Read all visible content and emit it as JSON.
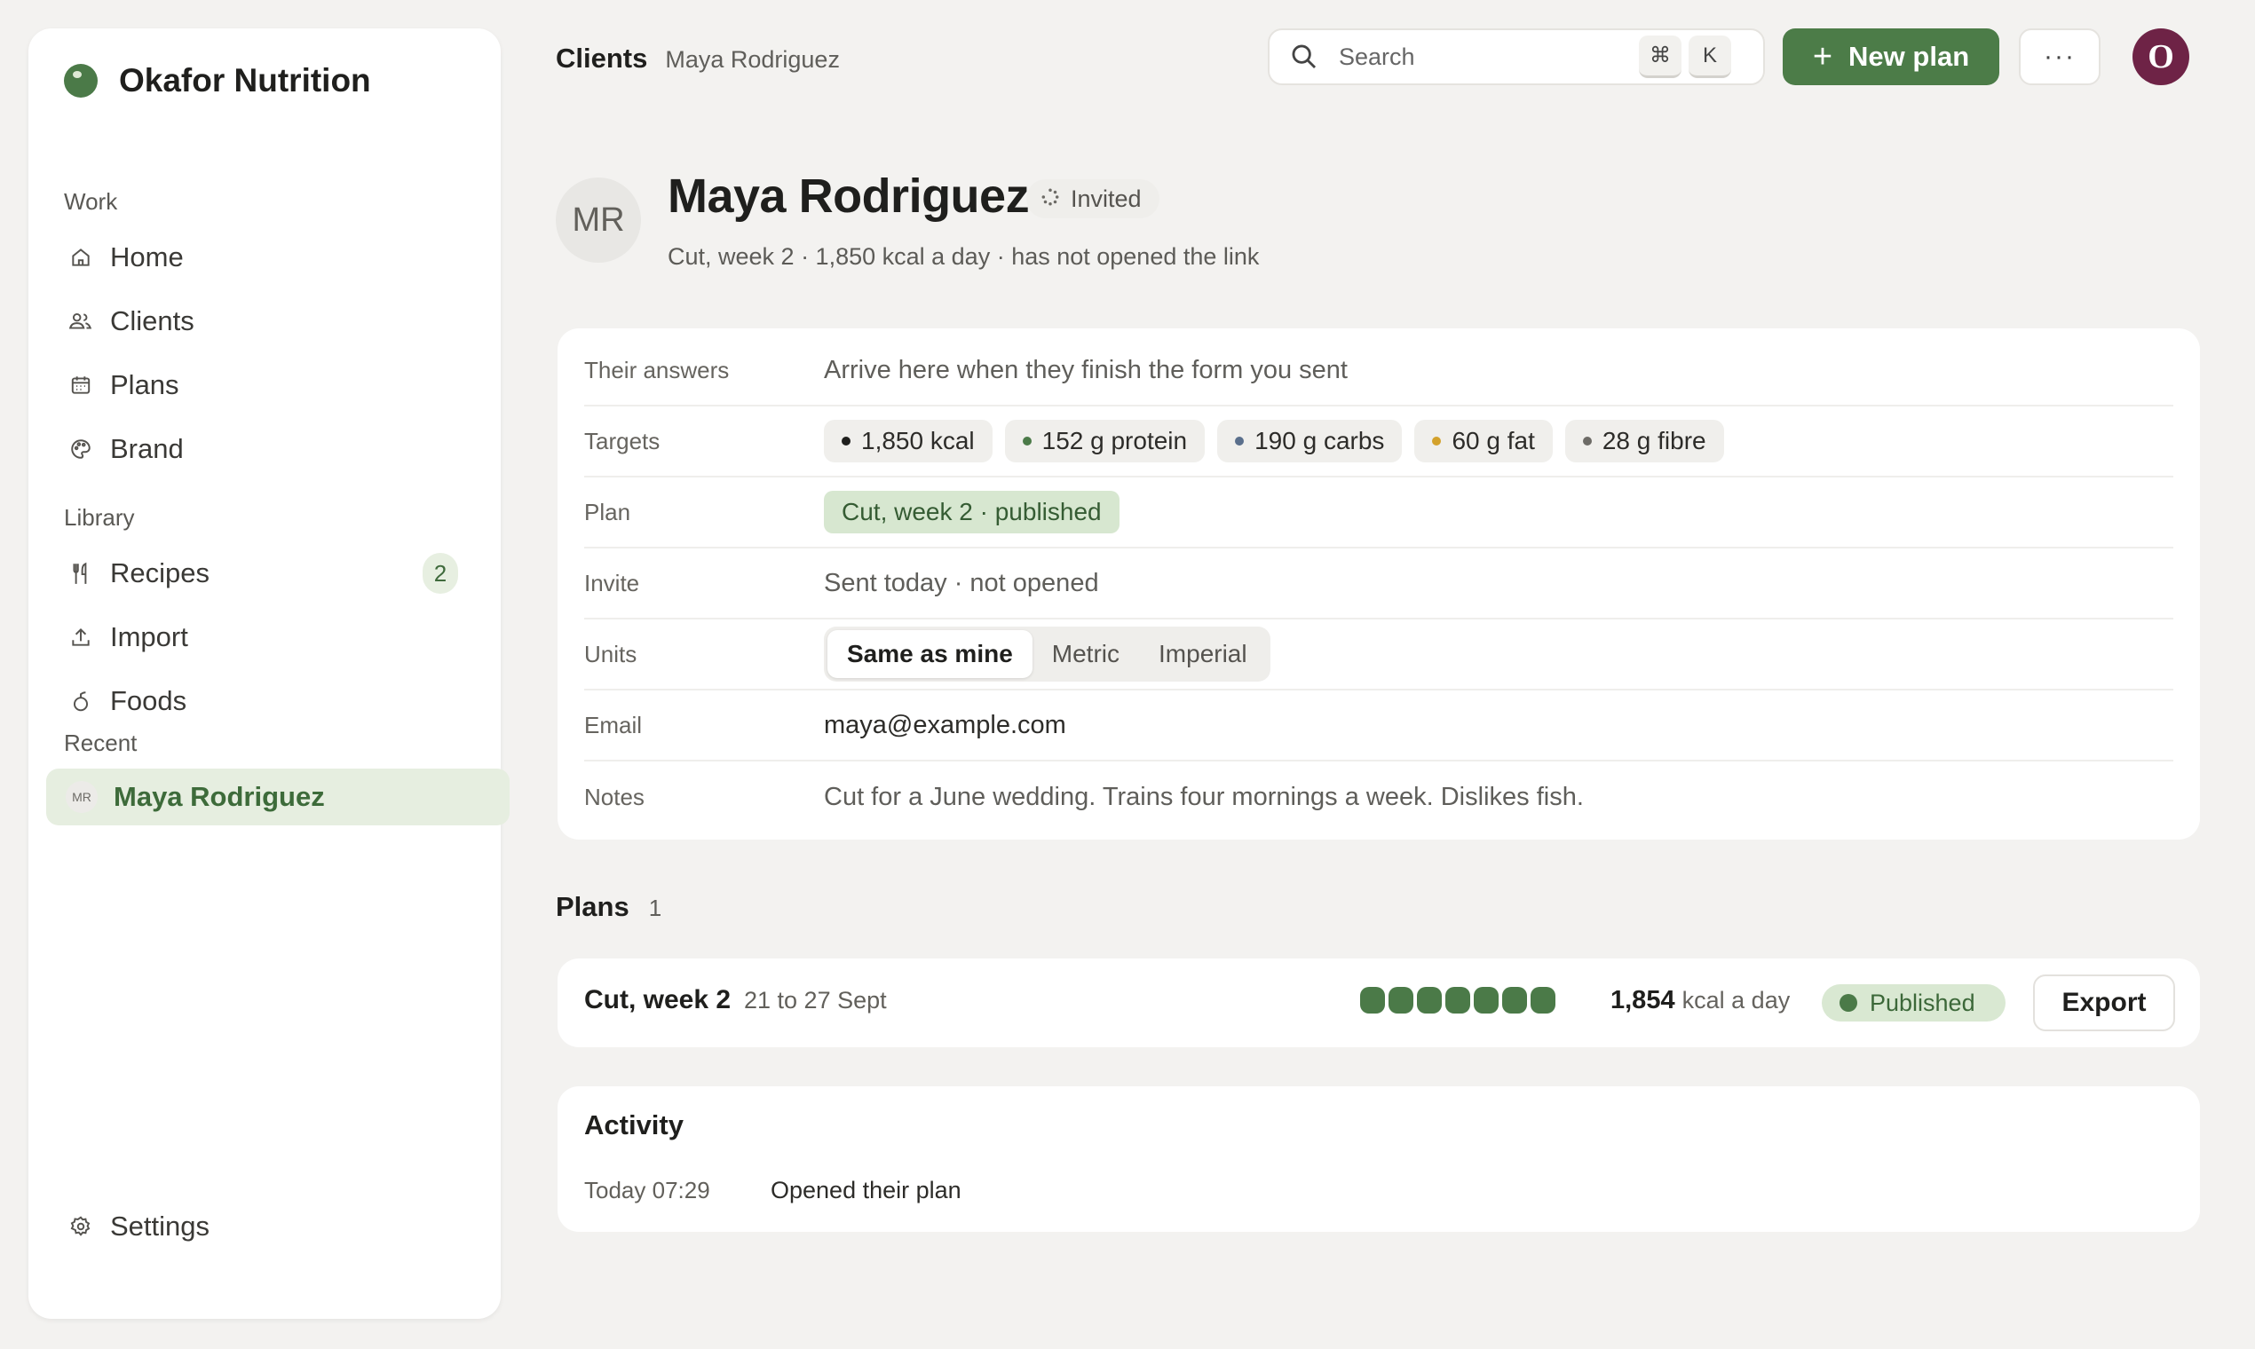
{
  "sidebar": {
    "brand": "Okafor Nutrition",
    "sections": {
      "work": "Work",
      "library": "Library",
      "recent": "Recent"
    },
    "work_items": [
      {
        "label": "Home",
        "icon": "home-icon"
      },
      {
        "label": "Clients",
        "icon": "users-icon"
      },
      {
        "label": "Plans",
        "icon": "calendar-icon"
      },
      {
        "label": "Brand",
        "icon": "palette-icon"
      }
    ],
    "library_items": [
      {
        "label": "Recipes",
        "icon": "utensils-icon",
        "badge": "2"
      },
      {
        "label": "Import",
        "icon": "upload-icon"
      },
      {
        "label": "Foods",
        "icon": "apple-icon"
      }
    ],
    "recent": {
      "initials": "MR",
      "label": "Maya Rodriguez"
    },
    "settings": "Settings"
  },
  "topbar": {
    "breadcrumb_main": "Clients",
    "breadcrumb_sub": "Maya Rodriguez",
    "search_placeholder": "Search",
    "kbd_cmd": "⌘",
    "kbd_k": "K",
    "new_plan": "New plan",
    "more": "···",
    "user_initial": "O"
  },
  "client": {
    "initials": "MR",
    "name": "Maya Rodriguez",
    "status": "Invited",
    "subtitle": "Cut, week 2 · 1,850 kcal a day · has not opened the link"
  },
  "details": {
    "answers_label": "Their answers",
    "answers_value": "Arrive here when they finish the form you sent",
    "targets_label": "Targets",
    "targets": [
      {
        "text": "1,850 kcal",
        "color": "#1f1f1d"
      },
      {
        "text": "152 g protein",
        "color": "#4b7a48"
      },
      {
        "text": "190 g carbs",
        "color": "#5a6f8c"
      },
      {
        "text": "60 g fat",
        "color": "#d3a12b"
      },
      {
        "text": "28 g fibre",
        "color": "#6d6b66"
      }
    ],
    "plan_label": "Plan",
    "plan_value": "Cut, week 2 · published",
    "invite_label": "Invite",
    "invite_value": "Sent today · not opened",
    "units_label": "Units",
    "units_options": [
      "Same as mine",
      "Metric",
      "Imperial"
    ],
    "units_selected": "Same as mine",
    "email_label": "Email",
    "email_value": "maya@example.com",
    "notes_label": "Notes",
    "notes_value": "Cut for a June wedding. Trains four mornings a week. Dislikes fish."
  },
  "plans": {
    "title": "Plans",
    "count": "1",
    "items": [
      {
        "name": "Cut, week 2",
        "dates": "21 to 27 Sept",
        "days_filled": 7,
        "kcal_value": "1,854",
        "kcal_unit": "kcal a day",
        "status": "Published",
        "export": "Export"
      }
    ]
  },
  "activity": {
    "title": "Activity",
    "entries": [
      {
        "time": "Today 07:29",
        "text": "Opened their plan"
      }
    ]
  },
  "colors": {
    "accent": "#4c7c48",
    "avatar": "#6e2346",
    "background": "#f3f2f0"
  }
}
